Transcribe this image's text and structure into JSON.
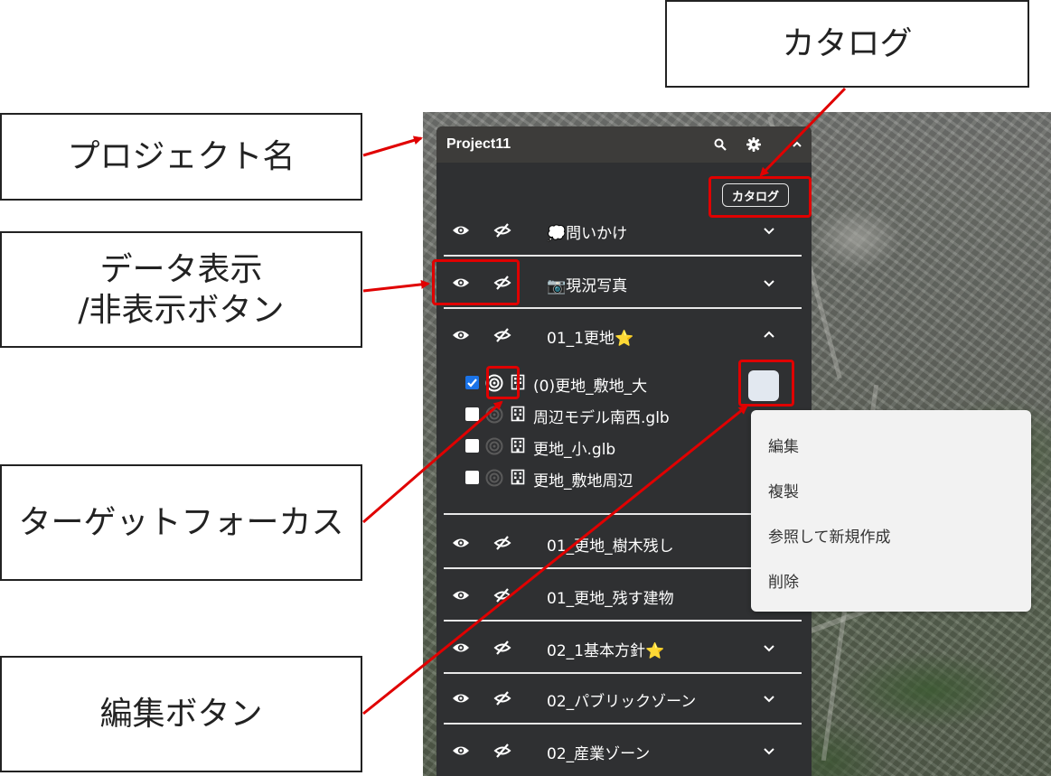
{
  "panel": {
    "project_name": "Project11",
    "catalog_button": "カタログ"
  },
  "layers": [
    {
      "name": "💭問いかけ",
      "expanded": false
    },
    {
      "name": "📷現況写真",
      "expanded": false
    },
    {
      "name": "01_1更地⭐",
      "expanded": true
    },
    {
      "name": "01_更地_樹木残し",
      "expanded": false
    },
    {
      "name": "01_更地_残す建物",
      "expanded": false
    },
    {
      "name": "02_1基本方針⭐",
      "expanded": false
    },
    {
      "name": "02_パブリックゾーン",
      "expanded": false
    },
    {
      "name": "02_産業ゾーン",
      "expanded": false
    }
  ],
  "sub_items": [
    {
      "name": "(0)更地_敷地_大",
      "checked": true
    },
    {
      "name": "周辺モデル南西.glb",
      "checked": false
    },
    {
      "name": "更地_小.glb",
      "checked": false
    },
    {
      "name": "更地_敷地周辺",
      "checked": false
    }
  ],
  "context_menu": [
    "編集",
    "複製",
    "参照して新規作成",
    "削除"
  ],
  "callouts": {
    "catalog": "カタログ",
    "project_name": "プロジェクト名",
    "visibility": "データ表示\n/非表示ボタン",
    "target_focus": "ターゲットフォーカス",
    "edit": "編集ボタン"
  },
  "colors": {
    "panel_bg": "#2f3032",
    "header_bg": "#3d3c3a",
    "highlight": "#e00000",
    "checkbox_on": "#1a73e8"
  }
}
